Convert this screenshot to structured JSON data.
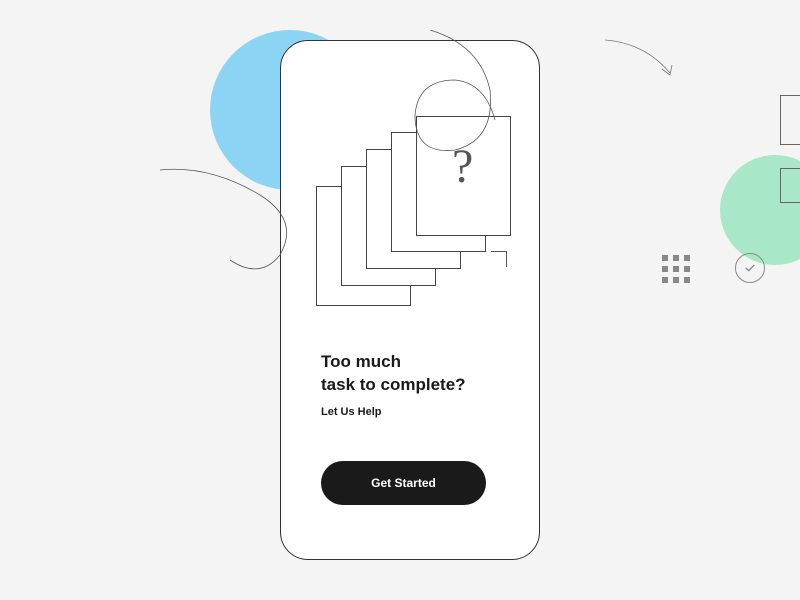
{
  "onboarding": {
    "heading_line1": "Too much",
    "heading_line2": "task to complete?",
    "subheading": "Let Us Help",
    "cta_label": "Get Started"
  },
  "illustration": {
    "question_mark": "?"
  }
}
